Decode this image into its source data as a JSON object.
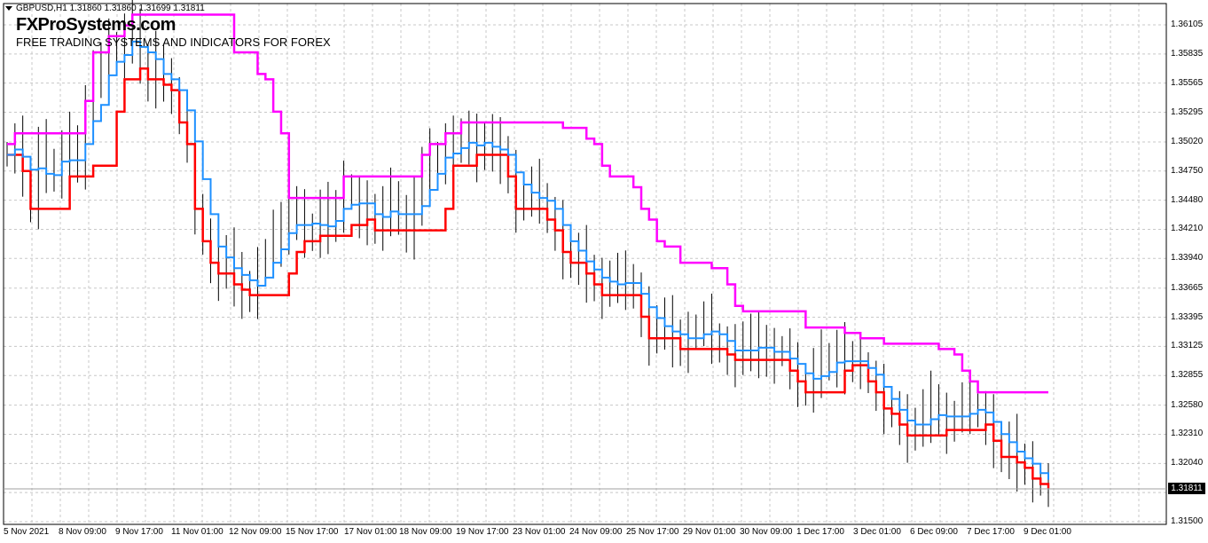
{
  "header": {
    "symbol_line": "GBPUSD,H1  1.31860 1.31860 1.31699 1.31811",
    "brand_title": "FXProSystems.com",
    "brand_subtitle": "FREE TRADING SYSTEMS AND INDICATORS FOR FOREX"
  },
  "colors": {
    "background": "#ffffff",
    "grid": "#c8c8c8",
    "bars": "#000000",
    "trend_red": "#ff0000",
    "trend_blue": "#1e90ff",
    "trend_magenta": "#ff00ff",
    "trend_green": "#00dd00"
  },
  "current_price": "1.31811",
  "chart_data": {
    "type": "line",
    "y_axis": {
      "range": [
        1.315,
        1.3628
      ],
      "tick_labels": [
        "1.36105",
        "1.35835",
        "1.35565",
        "1.35295",
        "1.35020",
        "1.34750",
        "1.34480",
        "1.34210",
        "1.33940",
        "1.33665",
        "1.33395",
        "1.33125",
        "1.32855",
        "1.32580",
        "1.32310",
        "1.32040",
        "1.31770",
        "1.31500"
      ]
    },
    "x_axis": {
      "tick_labels": [
        "5 Nov 2021",
        "8 Nov 09:00",
        "9 Nov 17:00",
        "11 Nov 01:00",
        "12 Nov 09:00",
        "15 Nov 17:00",
        "17 Nov 01:00",
        "18 Nov 09:00",
        "19 Nov 17:00",
        "23 Nov 01:00",
        "24 Nov 09:00",
        "25 Nov 17:00",
        "29 Nov 01:00",
        "30 Nov 09:00",
        "1 Dec 17:00",
        "3 Dec 01:00",
        "6 Dec 09:00",
        "7 Dec 17:00",
        "9 Dec 01:00"
      ]
    },
    "grid": true,
    "close_series": [
      1.349,
      1.35,
      1.3475,
      1.344,
      1.3495,
      1.348,
      1.347,
      1.349,
      1.35,
      1.348,
      1.353,
      1.3575,
      1.356,
      1.359,
      1.358,
      1.36,
      1.361,
      1.357,
      1.356,
      1.3575,
      1.3555,
      1.355,
      1.352,
      1.35,
      1.344,
      1.341,
      1.339,
      1.338,
      1.34,
      1.337,
      1.3365,
      1.336,
      1.338,
      1.34,
      1.342,
      1.341,
      1.344,
      1.343,
      1.342,
      1.3415,
      1.3435,
      1.3425,
      1.344,
      1.346,
      1.345,
      1.343,
      1.344,
      1.342,
      1.344,
      1.345,
      1.343,
      1.342,
      1.344,
      1.348,
      1.349,
      1.348,
      1.35,
      1.3495,
      1.351,
      1.35,
      1.349,
      1.3505,
      1.3495,
      1.349,
      1.347,
      1.344,
      1.345,
      1.346,
      1.345,
      1.343,
      1.342,
      1.34,
      1.339,
      1.3395,
      1.338,
      1.337,
      1.336,
      1.338,
      1.337,
      1.3375,
      1.336,
      1.334,
      1.332,
      1.3335,
      1.333,
      1.332,
      1.331,
      1.332,
      1.333,
      1.3335,
      1.332,
      1.331,
      1.3305,
      1.33,
      1.332,
      1.331,
      1.3315,
      1.33,
      1.3305,
      1.331,
      1.329,
      1.328,
      1.327,
      1.329,
      1.33,
      1.3295,
      1.3305,
      1.3295,
      1.33,
      1.3295,
      1.328,
      1.327,
      1.3255,
      1.325,
      1.324,
      1.323,
      1.324,
      1.325,
      1.326,
      1.3245,
      1.3235,
      1.325,
      1.326,
      1.3255,
      1.325,
      1.324,
      1.3225,
      1.321,
      1.322,
      1.3205,
      1.32,
      1.319,
      1.3185,
      1.3181
    ],
    "series": [
      {
        "color": "red",
        "values": [
          [
            1,
            1.351
          ],
          [
            4,
            1.351
          ],
          [
            5,
            1.35
          ],
          [
            6,
            1.349
          ],
          [
            6,
            1.347
          ],
          [
            20,
            1.347
          ],
          [
            21,
            1.349
          ],
          [
            22,
            1.3525
          ],
          [
            23,
            1.355
          ],
          [
            25,
            1.356
          ],
          [
            26,
            1.356
          ],
          [
            27,
            1.355
          ],
          [
            28,
            1.353
          ],
          [
            29,
            1.35
          ],
          [
            30,
            1.347
          ],
          [
            31,
            1.342
          ],
          [
            33,
            1.341
          ],
          [
            35,
            1.34
          ],
          [
            37,
            1.338
          ],
          [
            39,
            1.337
          ],
          [
            41,
            1.336
          ],
          [
            45,
            1.336
          ],
          [
            46,
            1.337
          ],
          [
            47,
            1.338
          ],
          [
            55,
            1.338
          ],
          [
            56,
            1.34
          ],
          [
            57,
            1.341
          ],
          [
            62,
            1.342
          ],
          [
            73,
            1.342
          ],
          [
            74,
            1.344
          ],
          [
            75,
            1.346
          ],
          [
            88,
            1.346
          ],
          [
            92,
            1.345
          ],
          [
            96,
            1.343
          ],
          [
            98,
            1.342
          ],
          [
            100,
            1.341
          ],
          [
            105,
            1.34
          ],
          [
            107,
            1.338
          ],
          [
            110,
            1.337
          ],
          [
            115,
            1.337
          ],
          [
            116,
            1.335
          ],
          [
            118,
            1.334
          ],
          [
            120,
            1.333
          ],
          [
            125,
            1.331
          ],
          [
            127,
            1.33
          ],
          [
            130,
            1.329
          ],
          [
            133,
            1.328
          ],
          [
            136,
            1.326
          ],
          [
            138,
            1.325
          ],
          [
            140,
            1.324
          ],
          [
            142,
            1.324
          ],
          [
            145,
            1.323
          ],
          [
            150,
            1.323
          ],
          [
            152,
            1.323
          ],
          [
            155,
            1.323
          ],
          [
            158,
            1.323
          ],
          [
            160,
            1.324
          ],
          [
            163,
            1.323
          ],
          [
            165,
            1.3225
          ],
          [
            168,
            1.322
          ],
          [
            170,
            1.321
          ],
          [
            172,
            1.32
          ],
          [
            175,
            1.319
          ],
          [
            178,
            1.318
          ],
          [
            180,
            1.319
          ],
          [
            182,
            1.32
          ],
          [
            185,
            1.321
          ],
          [
            188,
            1.3215
          ],
          [
            190,
            1.322
          ],
          [
            193,
            1.322
          ],
          [
            195,
            1.3215
          ],
          [
            198,
            1.321
          ],
          [
            200,
            1.32
          ],
          [
            203,
            1.319
          ],
          [
            205,
            1.318
          ],
          [
            208,
            1.3175
          ],
          [
            210,
            1.318
          ],
          [
            213,
            1.3175
          ],
          [
            215,
            1.317
          ],
          [
            218,
            1.318
          ],
          [
            220,
            1.319
          ],
          [
            222,
            1.3195
          ],
          [
            225,
            1.32
          ],
          [
            228,
            1.3205
          ],
          [
            230,
            1.321
          ]
        ]
      }
    ]
  }
}
